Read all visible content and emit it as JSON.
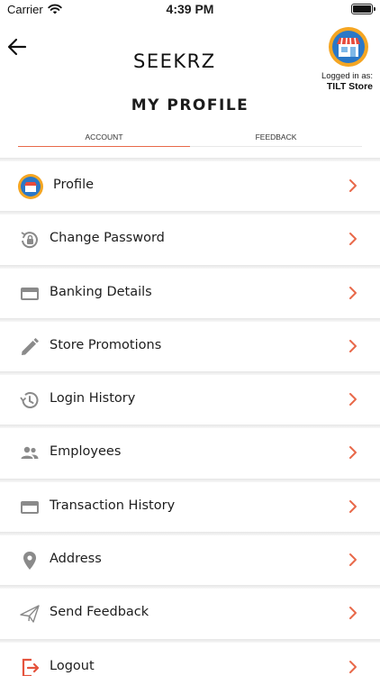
{
  "status_bar": {
    "carrier": "Carrier",
    "time": "4:39 PM"
  },
  "header": {
    "logo_text": "SEEKRZ",
    "logged_in_label": "Logged in as:",
    "store_name": "TILT Store",
    "page_title": "MY PROFILE"
  },
  "tabs": [
    {
      "label": "ACCOUNT",
      "active": true
    },
    {
      "label": "FEEDBACK",
      "active": false
    }
  ],
  "menu": [
    {
      "label": "Profile",
      "icon": "store-avatar-icon"
    },
    {
      "label": "Change Password",
      "icon": "lock-reset-icon"
    },
    {
      "label": "Banking Details",
      "icon": "credit-card-icon"
    },
    {
      "label": "Store Promotions",
      "icon": "pencil-icon"
    },
    {
      "label": "Login History",
      "icon": "history-icon"
    },
    {
      "label": "Employees",
      "icon": "people-icon"
    },
    {
      "label": "Transaction History",
      "icon": "credit-card-icon"
    },
    {
      "label": "Address",
      "icon": "location-pin-icon"
    },
    {
      "label": "Send Feedback",
      "icon": "paper-plane-icon"
    },
    {
      "label": "Logout",
      "icon": "logout-icon"
    }
  ],
  "colors": {
    "accent": "#e8694a",
    "avatar_ring": "#f5a623",
    "avatar_fill": "#2a78c8",
    "icon_gray": "#8a8a8a",
    "logout_red": "#e5533d"
  }
}
